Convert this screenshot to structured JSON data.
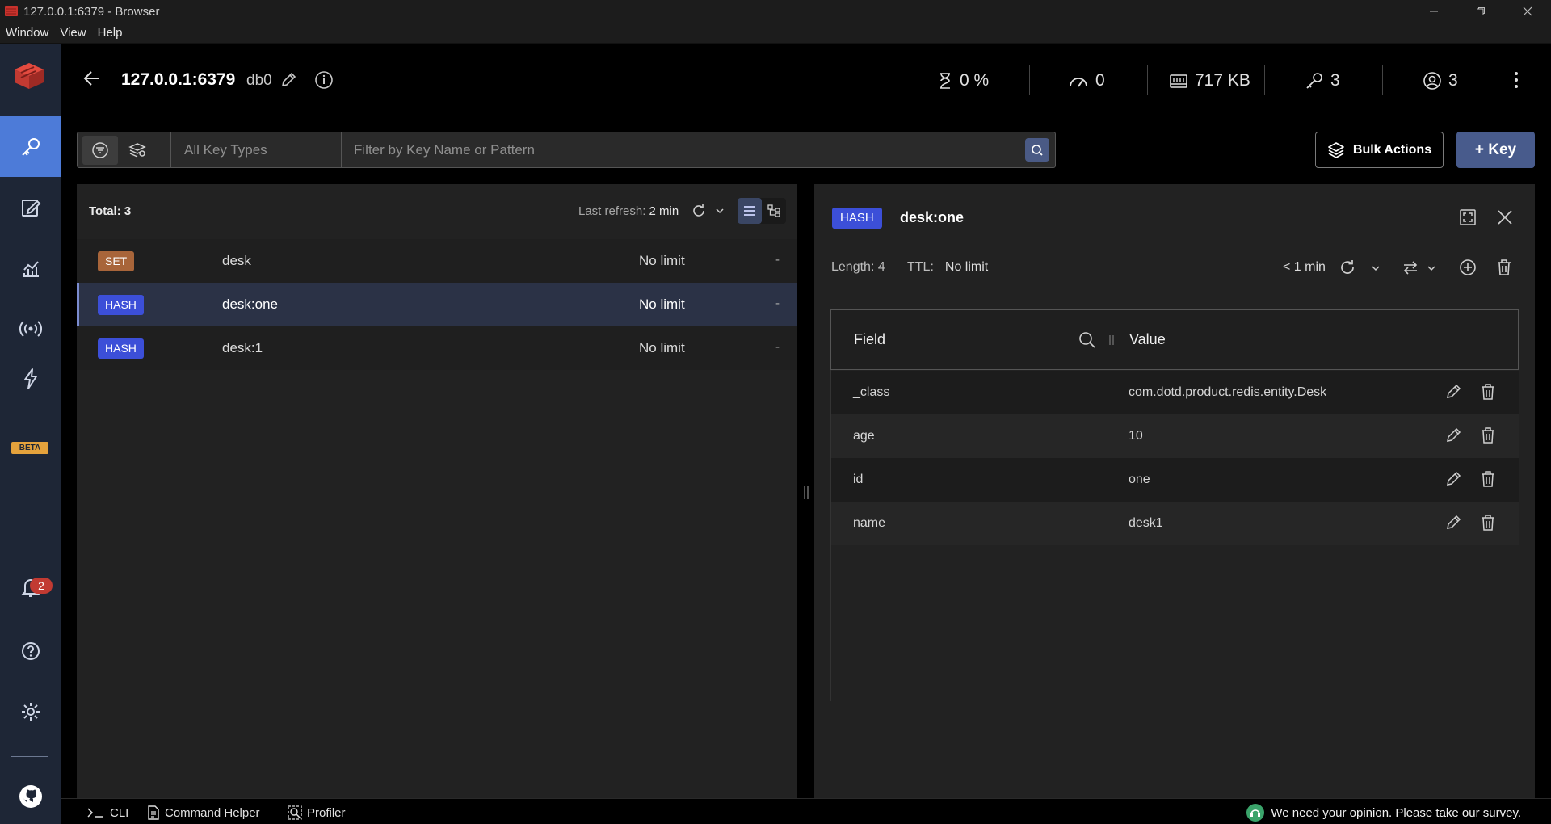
{
  "window": {
    "title": "127.0.0.1:6379 - Browser"
  },
  "menu": [
    "Window",
    "View",
    "Help"
  ],
  "nav": {
    "beta_label": "BETA",
    "notifications_count": "2"
  },
  "header": {
    "host": "127.0.0.1:6379",
    "db": "db0",
    "stats": {
      "cpu": "0 %",
      "ops": "0",
      "memory": "717 KB",
      "keys": "3",
      "clients": "3"
    }
  },
  "filter": {
    "key_types": "All Key Types",
    "placeholder": "Filter by Key Name or Pattern"
  },
  "actions": {
    "bulk_label": "Bulk Actions",
    "add_key_label": "+ Key"
  },
  "keylist": {
    "total_label": "Total: 3",
    "refresh_prefix": "Last refresh: ",
    "refresh_value": "2 min",
    "rows": [
      {
        "type": "SET",
        "name": "desk",
        "ttl": "No limit",
        "size": "-"
      },
      {
        "type": "HASH",
        "name": "desk:one",
        "ttl": "No limit",
        "size": "-"
      },
      {
        "type": "HASH",
        "name": "desk:1",
        "ttl": "No limit",
        "size": "-"
      }
    ]
  },
  "detail": {
    "type": "HASH",
    "name": "desk:one",
    "length_label": "Length: 4",
    "ttl_label": "TTL:",
    "ttl_value": "No limit",
    "refreshed": "< 1 min",
    "columns": {
      "field": "Field",
      "value": "Value"
    },
    "rows": [
      {
        "field": "_class",
        "value": "com.dotd.product.redis.entity.Desk"
      },
      {
        "field": "age",
        "value": "10"
      },
      {
        "field": "id",
        "value": "one"
      },
      {
        "field": "name",
        "value": "desk1"
      }
    ]
  },
  "bottom": {
    "cli": "CLI",
    "helper": "Command Helper",
    "profiler": "Profiler",
    "survey": "We need your opinion. Please take our survey."
  },
  "colors": {
    "accent": "#4d7bd8",
    "hash": "#3c4fd8",
    "set": "#a8653a",
    "nav_bg": "#1e2636"
  }
}
